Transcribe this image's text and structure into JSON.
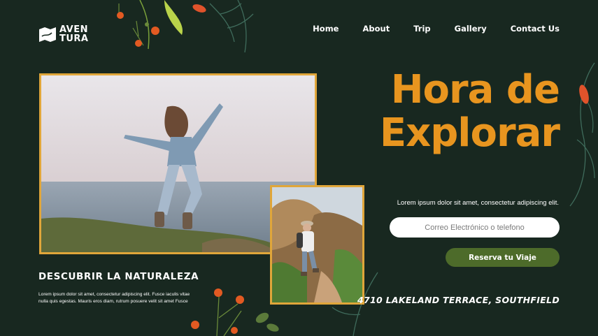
{
  "brand": {
    "line1": "AVEN",
    "line2": "TURA"
  },
  "nav": [
    {
      "label": "Home"
    },
    {
      "label": "About"
    },
    {
      "label": "Trip"
    },
    {
      "label": "Gallery"
    },
    {
      "label": "Contact Us"
    }
  ],
  "hero": {
    "title_line1": "Hora de",
    "title_line2": "Explorar",
    "description": "Lorem ipsum dolor sit amet, consectetur adipiscing elit.",
    "input_placeholder": "Correo Electrónico o telefono",
    "cta_label": "Reserva tu Viaje",
    "address": "4710 LAKELAND TERRACE, SOUTHFIELD"
  },
  "section": {
    "title": "DESCUBRIR LA NATURALEZA",
    "text": "Lorem ipsum dolor sit amet, consectetur adipiscing elit. Fusce iaculis vitae nulla quis egestas. Mauris eros diam, rutrum posuere velit sit amet Fusce"
  },
  "colors": {
    "background": "#182820",
    "accent_orange": "#e8951f",
    "photo_border": "#e0a63a",
    "button_green": "#4d6b2a"
  },
  "icons": [
    "logo-mark-icon",
    "flower-decoration",
    "leaf-decoration"
  ]
}
